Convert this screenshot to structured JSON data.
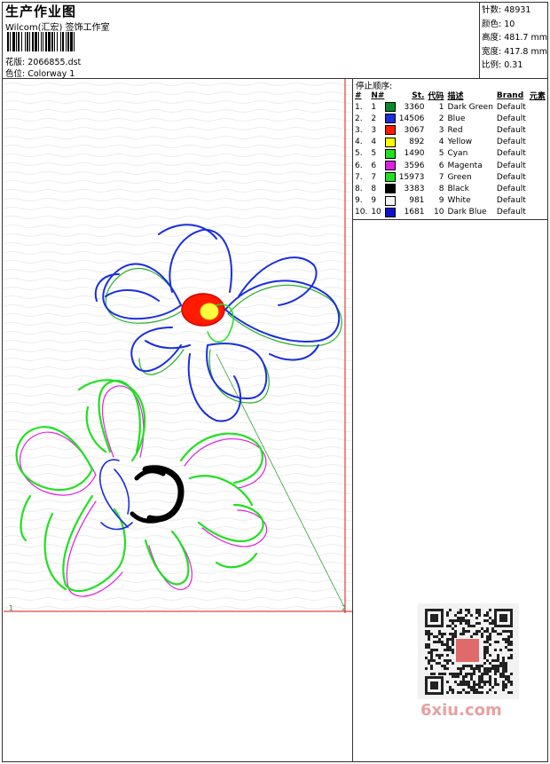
{
  "header": {
    "title": "生产作业图",
    "company": "Wilcom(汇宏) 签饰工作室",
    "file_label": "花版:",
    "file_name": "2066855.dst",
    "colorway_label": "色位:",
    "colorway_name": "Colorway 1"
  },
  "stats": [
    {
      "label": "针数:",
      "value": "48931"
    },
    {
      "label": "颜色:",
      "value": "10"
    },
    {
      "label": "高度:",
      "value": "481.7 mm"
    },
    {
      "label": "宽度:",
      "value": "417.8 mm"
    },
    {
      "label": "比例:",
      "value": "0.31"
    }
  ],
  "stop_sequence": {
    "title": "停止顺序:",
    "columns": [
      "#",
      "N#",
      "St.",
      "代码",
      "描述",
      "Brand",
      "元素"
    ],
    "rows": [
      {
        "idx": "1.",
        "n": "1",
        "st": "3360",
        "code": "1",
        "desc": "Dark Green",
        "brand": "Default",
        "color": "#0a8a2a"
      },
      {
        "idx": "2.",
        "n": "2",
        "st": "14506",
        "code": "2",
        "desc": "Blue",
        "brand": "Default",
        "color": "#1a2ee0"
      },
      {
        "idx": "3.",
        "n": "3",
        "st": "3067",
        "code": "3",
        "desc": "Red",
        "brand": "Default",
        "color": "#ff1a00"
      },
      {
        "idx": "4.",
        "n": "4",
        "st": "892",
        "code": "4",
        "desc": "Yellow",
        "brand": "Default",
        "color": "#ffff00"
      },
      {
        "idx": "5.",
        "n": "5",
        "st": "1490",
        "code": "5",
        "desc": "Cyan",
        "brand": "Default",
        "color": "#22e022"
      },
      {
        "idx": "6.",
        "n": "6",
        "st": "3596",
        "code": "6",
        "desc": "Magenta",
        "brand": "Default",
        "color": "#e020e0"
      },
      {
        "idx": "7.",
        "n": "7",
        "st": "15973",
        "code": "7",
        "desc": "Green",
        "brand": "Default",
        "color": "#20e020"
      },
      {
        "idx": "8.",
        "n": "8",
        "st": "3383",
        "code": "8",
        "desc": "Black",
        "brand": "Default",
        "color": "#000000"
      },
      {
        "idx": "9.",
        "n": "9",
        "st": "981",
        "code": "9",
        "desc": "White",
        "brand": "Default",
        "color": "#f4f4f4"
      },
      {
        "idx": "10.",
        "n": "10",
        "st": "1681",
        "code": "10",
        "desc": "Dark Blue",
        "brand": "Default",
        "color": "#1010d0"
      }
    ]
  },
  "markers": {
    "start": "1",
    "end": "2"
  },
  "watermark": "6xiu.com"
}
